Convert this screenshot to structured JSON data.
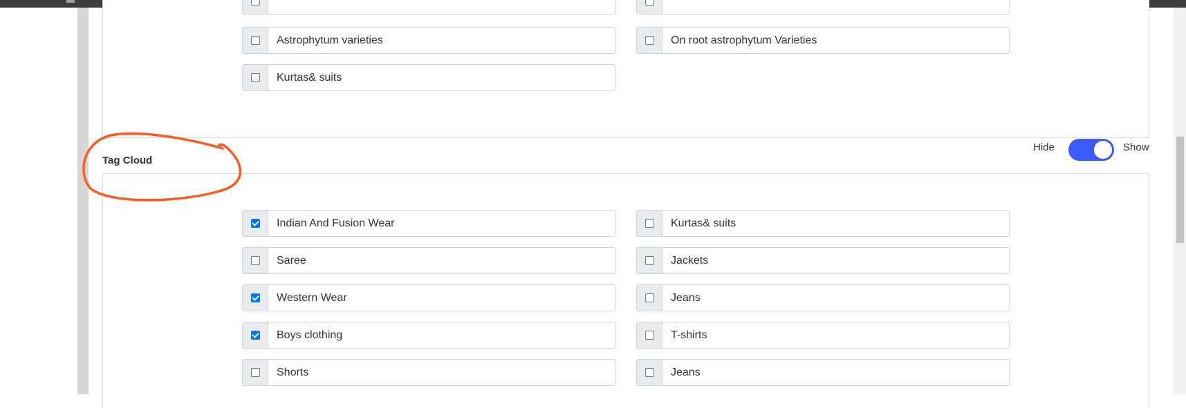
{
  "top_section": {
    "items": [
      {
        "label": "Astrophytum varieties",
        "checked": false
      },
      {
        "label": "On root astrophytum Varieties",
        "checked": false
      },
      {
        "label": "Kurtas& suits",
        "checked": false
      }
    ]
  },
  "tag_cloud": {
    "title": "Tag Cloud",
    "toggle": {
      "hide_label": "Hide",
      "show_label": "Show",
      "state": "show"
    },
    "items_left": [
      {
        "label": "Indian And Fusion Wear",
        "checked": true
      },
      {
        "label": "Saree",
        "checked": false
      },
      {
        "label": "Western Wear",
        "checked": true
      },
      {
        "label": "Boys clothing",
        "checked": true
      },
      {
        "label": "Shorts",
        "checked": false
      }
    ],
    "items_right": [
      {
        "label": "Kurtas& suits",
        "checked": false
      },
      {
        "label": "Jackets",
        "checked": false
      },
      {
        "label": "Jeans",
        "checked": false
      },
      {
        "label": "T-shirts",
        "checked": false
      },
      {
        "label": "Jeans",
        "checked": false
      }
    ]
  },
  "colors": {
    "accent": "#3d5afe",
    "checkbox_checked": "#0075ff",
    "annotation": "#ff5a1f"
  }
}
